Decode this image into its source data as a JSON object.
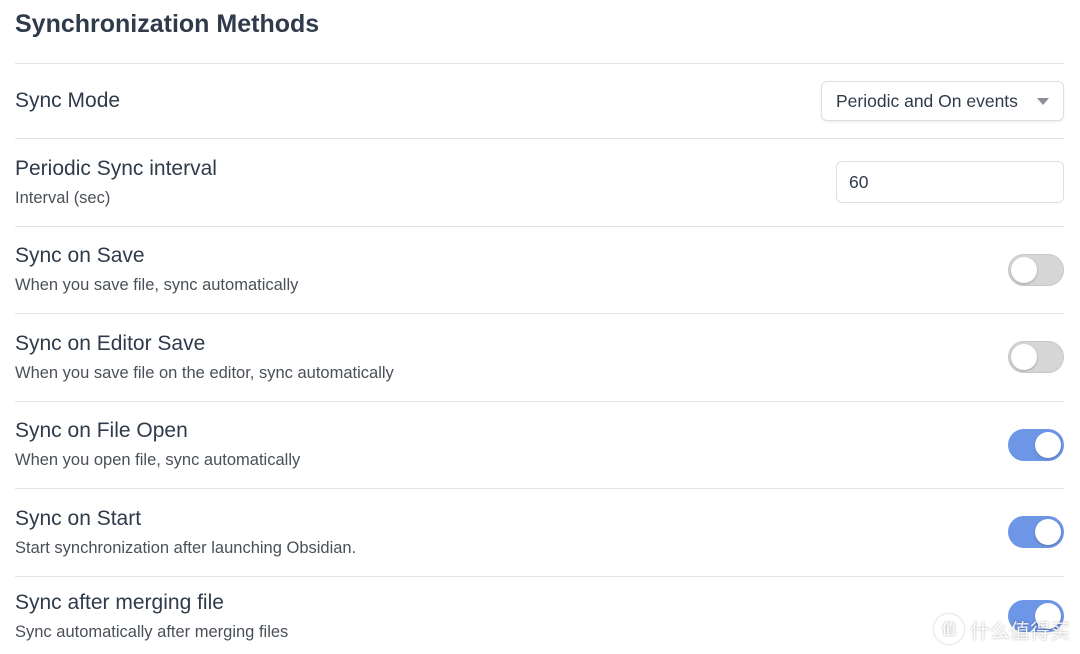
{
  "section": {
    "title": "Synchronization Methods"
  },
  "sync_mode": {
    "label": "Sync Mode",
    "selected": "Periodic and On events"
  },
  "periodic_interval": {
    "label": "Periodic Sync interval",
    "description": "Interval (sec)",
    "value": "60"
  },
  "toggles": [
    {
      "label": "Sync on Save",
      "description": "When you save file, sync automatically",
      "enabled": false
    },
    {
      "label": "Sync on Editor Save",
      "description": "When you save file on the editor, sync automatically",
      "enabled": false
    },
    {
      "label": "Sync on File Open",
      "description": "When you open file, sync automatically",
      "enabled": true
    },
    {
      "label": "Sync on Start",
      "description": "Start synchronization after launching Obsidian.",
      "enabled": true
    },
    {
      "label": "Sync after merging file",
      "description": "Sync automatically after merging files",
      "enabled": true
    }
  ],
  "colors": {
    "accent": "#6e96e6",
    "toggle_off": "#d6d6d6",
    "heading": "#2f3b4a"
  },
  "watermark": {
    "logo_glyph": "值",
    "text": "什么值得买"
  }
}
